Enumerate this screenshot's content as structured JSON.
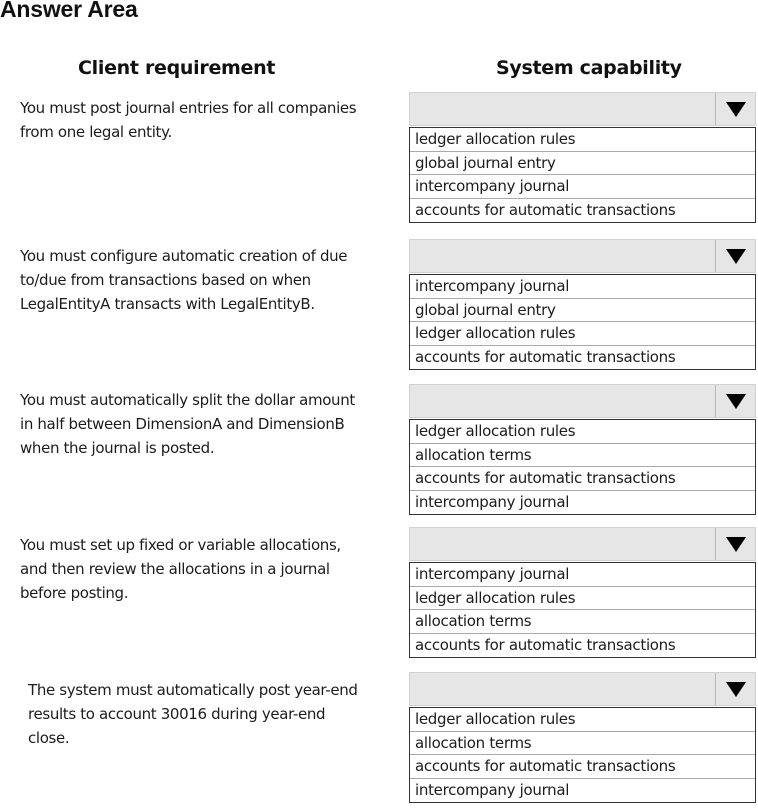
{
  "title": "Answer Area",
  "columns": {
    "left": "Client requirement",
    "right": "System capability"
  },
  "rows": [
    {
      "requirement": [
        "You must post journal entries for all companies",
        "from one legal entity."
      ],
      "selected": "",
      "options": [
        "ledger allocation rules",
        "global journal entry",
        "intercompany journal",
        "accounts for automatic transactions"
      ]
    },
    {
      "requirement": [
        "You must configure automatic creation of due",
        "to/due from transactions based on when",
        "LegalEntityA transacts with LegalEntityB."
      ],
      "selected": "",
      "options": [
        "intercompany journal",
        "global journal entry",
        "ledger allocation rules",
        "accounts for automatic transactions"
      ]
    },
    {
      "requirement": [
        "You must automatically split the dollar amount",
        "in half between DimensionA and DimensionB",
        "when the journal is posted."
      ],
      "selected": "",
      "options": [
        "ledger allocation rules",
        "allocation terms",
        "accounts for automatic transactions",
        "intercompany journal"
      ]
    },
    {
      "requirement": [
        "You must set up fixed or variable allocations,",
        "and then review the allocations in a journal",
        "before posting."
      ],
      "selected": "",
      "options": [
        "intercompany journal",
        "ledger allocation rules",
        "allocation terms",
        "accounts for automatic transactions"
      ]
    },
    {
      "requirement": [
        "The system must automatically post year-end",
        "results to account 30016 during year-end",
        "close."
      ],
      "selected": "",
      "options": [
        "ledger allocation rules",
        "allocation terms",
        "accounts for automatic transactions",
        "intercompany journal"
      ]
    }
  ],
  "icons": {
    "dropdown": "triangle-down-icon"
  }
}
